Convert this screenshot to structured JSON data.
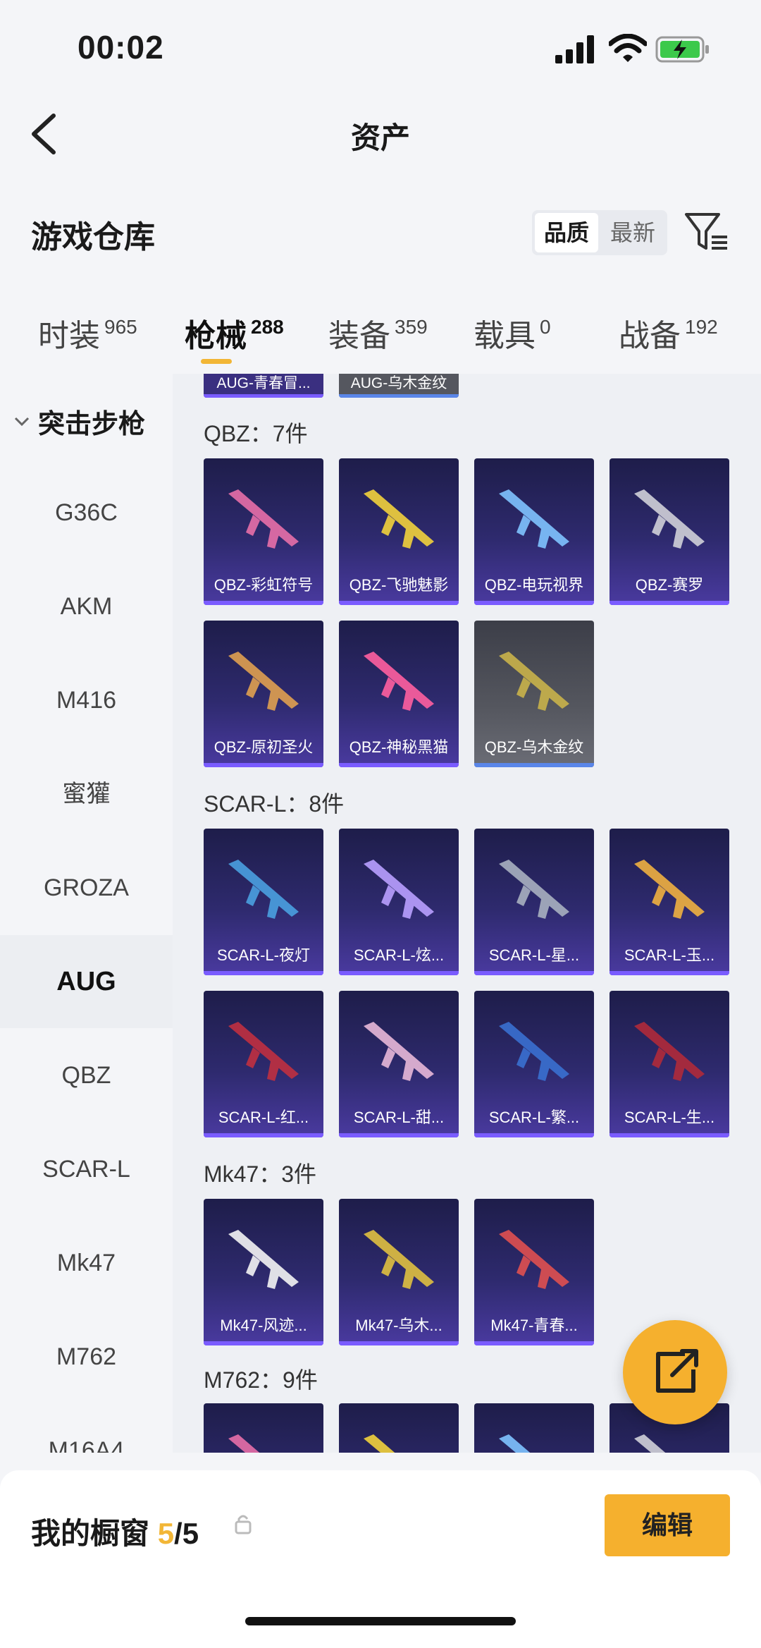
{
  "status": {
    "time": "00:02"
  },
  "nav": {
    "title": "资产"
  },
  "header": {
    "title": "游戏仓库",
    "sort_quality": "品质",
    "sort_latest": "最新"
  },
  "tabs": [
    {
      "label": "时装",
      "count": "965"
    },
    {
      "label": "枪械",
      "count": "288"
    },
    {
      "label": "装备",
      "count": "359"
    },
    {
      "label": "载具",
      "count": "0"
    },
    {
      "label": "战备",
      "count": "192"
    }
  ],
  "sidebar": {
    "category": "突击步枪",
    "items": [
      "G36C",
      "AKM",
      "M416",
      "蜜獾",
      "GROZA",
      "AUG",
      "QBZ",
      "SCAR-L",
      "Mk47",
      "M762",
      "M16A4"
    ],
    "active": "AUG"
  },
  "top_partial": [
    "AUG-青春冒...",
    "AUG-乌木金纹"
  ],
  "groups": [
    {
      "title": "QBZ：7件",
      "items": [
        "QBZ-彩虹符号",
        "QBZ-飞驰魅影",
        "QBZ-电玩视界",
        "QBZ-赛罗",
        "QBZ-原初圣火",
        "QBZ-神秘黑猫",
        "QBZ-乌木金纹"
      ]
    },
    {
      "title": "SCAR-L：8件",
      "items": [
        "SCAR-L-夜灯",
        "SCAR-L-炫...",
        "SCAR-L-星...",
        "SCAR-L-玉...",
        "SCAR-L-红...",
        "SCAR-L-甜...",
        "SCAR-L-繁...",
        "SCAR-L-生..."
      ]
    },
    {
      "title": "Mk47：3件",
      "items": [
        "Mk47-风迹...",
        "Mk47-乌木...",
        "Mk47-青春..."
      ]
    },
    {
      "title": "M762：9件",
      "items": []
    }
  ],
  "bottom": {
    "label": "我的橱窗",
    "count_current": "5",
    "count_total": "/5",
    "edit_label": "编辑"
  },
  "colors": {
    "accent": "#f5b02e",
    "card_purple": "#2e2a6e",
    "card_gray": "#55575f"
  }
}
